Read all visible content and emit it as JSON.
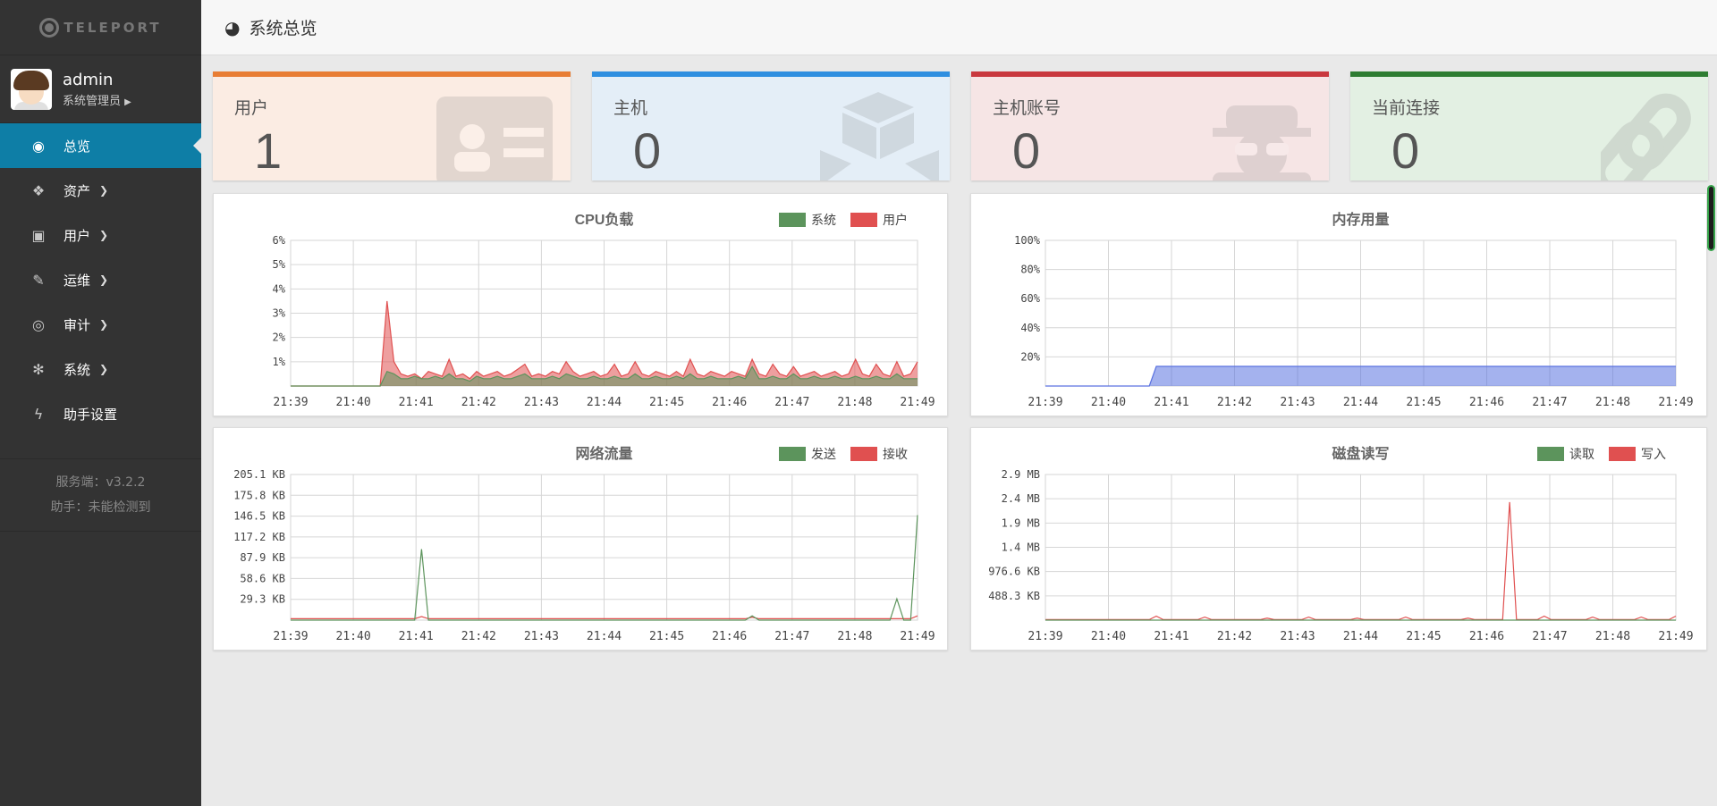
{
  "sidebar": {
    "logo": "TELEPORT",
    "user": {
      "name": "admin",
      "role": "系统管理员"
    },
    "items": [
      {
        "label": "总览",
        "icon": "dashboard-icon",
        "glyph": "◉",
        "active": true,
        "expandable": false
      },
      {
        "label": "资产",
        "icon": "cubes-icon",
        "glyph": "❖",
        "active": false,
        "expandable": true
      },
      {
        "label": "用户",
        "icon": "address-card-icon",
        "glyph": "▣",
        "active": false,
        "expandable": true
      },
      {
        "label": "运维",
        "icon": "wrench-icon",
        "glyph": "✎",
        "active": false,
        "expandable": true
      },
      {
        "label": "审计",
        "icon": "eye-icon",
        "glyph": "◎",
        "active": false,
        "expandable": true
      },
      {
        "label": "系统",
        "icon": "gear-icon",
        "glyph": "✻",
        "active": false,
        "expandable": true
      },
      {
        "label": "助手设置",
        "icon": "bolt-icon",
        "glyph": "ϟ",
        "active": false,
        "expandable": false
      }
    ],
    "version": {
      "server": "服务端：v3.2.2",
      "assistant": "助手：未能检测到"
    }
  },
  "header": {
    "title": "系统总览",
    "icon": "dashboard-icon"
  },
  "cards": [
    {
      "title": "用户",
      "value": "1",
      "color": "#e87d34",
      "bg": "#fbece3",
      "icon": "id-card-icon"
    },
    {
      "title": "主机",
      "value": "0",
      "color": "#2f8fe0",
      "bg": "#e4eef7",
      "icon": "cubes-icon"
    },
    {
      "title": "主机账号",
      "value": "0",
      "color": "#c9383e",
      "bg": "#f6e5e5",
      "icon": "user-secret-icon"
    },
    {
      "title": "当前连接",
      "value": "0",
      "color": "#2e7d32",
      "bg": "#e3f0e3",
      "icon": "link-icon"
    }
  ],
  "colors": {
    "green": "#5c945c",
    "red": "#e05050",
    "blue": "#5a72e0",
    "grid": "#d6d6d6"
  },
  "chart_data": [
    {
      "type": "area",
      "title": "CPU负载",
      "legend": [
        "系统",
        "用户"
      ],
      "x": [
        "21:39",
        "21:40",
        "21:41",
        "21:42",
        "21:43",
        "21:44",
        "21:45",
        "21:46",
        "21:47",
        "21:48",
        "21:49"
      ],
      "y_ticks": [
        "6%",
        "5%",
        "4%",
        "3%",
        "2%",
        "1%"
      ],
      "ylim": [
        0,
        6
      ],
      "series": [
        {
          "name": "系统",
          "color": "#5c945c",
          "values": [
            0,
            0,
            0,
            0,
            0,
            0,
            0,
            0,
            0,
            0,
            0,
            0,
            0,
            0,
            0.6,
            0.5,
            0.3,
            0.3,
            0.4,
            0.3,
            0.3,
            0.4,
            0.3,
            0.5,
            0.3,
            0.3,
            0.2,
            0.4,
            0.3,
            0.3,
            0.4,
            0.3,
            0.3,
            0.4,
            0.5,
            0.3,
            0.3,
            0.3,
            0.4,
            0.3,
            0.5,
            0.4,
            0.3,
            0.3,
            0.4,
            0.3,
            0.3,
            0.4,
            0.3,
            0.3,
            0.5,
            0.3,
            0.3,
            0.4,
            0.3,
            0.3,
            0.4,
            0.3,
            0.5,
            0.3,
            0.3,
            0.4,
            0.3,
            0.3,
            0.3,
            0.4,
            0.3,
            0.8,
            0.3,
            0.3,
            0.4,
            0.3,
            0.3,
            0.5,
            0.3,
            0.3,
            0.4,
            0.3,
            0.3,
            0.4,
            0.3,
            0.3,
            0.4,
            0.3,
            0.3,
            0.4,
            0.3,
            0.3,
            0.5,
            0.3,
            0.3,
            0.3
          ]
        },
        {
          "name": "用户",
          "color": "#e05050",
          "values": [
            0,
            0,
            0,
            0,
            0,
            0,
            0,
            0,
            0,
            0,
            0,
            0,
            0,
            0,
            3.5,
            1,
            0.5,
            0.4,
            0.5,
            0.3,
            0.6,
            0.5,
            0.4,
            1.1,
            0.4,
            0.5,
            0.3,
            0.6,
            0.4,
            0.5,
            0.6,
            0.4,
            0.5,
            0.7,
            0.9,
            0.4,
            0.5,
            0.4,
            0.6,
            0.5,
            1,
            0.6,
            0.4,
            0.5,
            0.6,
            0.4,
            0.5,
            0.9,
            0.4,
            0.5,
            1,
            0.5,
            0.4,
            0.6,
            0.5,
            0.4,
            0.6,
            0.4,
            1.1,
            0.5,
            0.4,
            0.6,
            0.5,
            0.4,
            0.6,
            0.5,
            0.4,
            1.1,
            0.5,
            0.4,
            0.9,
            0.5,
            0.4,
            0.8,
            0.4,
            0.5,
            0.6,
            0.4,
            0.5,
            0.6,
            0.4,
            0.5,
            1.1,
            0.5,
            0.4,
            0.9,
            0.5,
            0.4,
            1,
            0.4,
            0.5,
            1
          ]
        }
      ]
    },
    {
      "type": "area",
      "title": "内存用量",
      "legend": [],
      "x": [
        "21:39",
        "21:40",
        "21:41",
        "21:42",
        "21:43",
        "21:44",
        "21:45",
        "21:46",
        "21:47",
        "21:48",
        "21:49"
      ],
      "y_ticks": [
        "100%",
        "80%",
        "60%",
        "40%",
        "20%"
      ],
      "ylim": [
        0,
        100
      ],
      "series": [
        {
          "name": "",
          "color": "#5a72e0",
          "values": [
            0,
            0,
            0,
            0,
            0,
            0,
            0,
            0,
            0,
            0,
            0,
            0,
            0,
            0,
            0,
            0,
            13.5,
            13.5,
            13.5,
            13.5,
            13.5,
            13.5,
            13.5,
            13.5,
            13.5,
            13.5,
            13.5,
            13.5,
            13.5,
            13.5,
            13.5,
            13.5,
            13.5,
            13.5,
            13.5,
            13.5,
            13.5,
            13.5,
            13.5,
            13.5,
            13.5,
            13.5,
            13.5,
            13.5,
            13.5,
            13.5,
            13.5,
            13.5,
            13.5,
            13.5,
            13.5,
            13.5,
            13.5,
            13.5,
            13.5,
            13.5,
            13.5,
            13.5,
            13.5,
            13.5,
            13.5,
            13.5,
            13.5,
            13.5,
            13.5,
            13.5,
            13.5,
            13.5,
            13.5,
            13.5,
            13.5,
            13.5,
            13.5,
            13.5,
            13.5,
            13.5,
            13.5,
            13.5,
            13.5,
            13.5,
            13.5,
            13.5,
            13.5,
            13.5,
            13.5,
            13.5,
            13.5,
            13.5,
            13.5,
            13.5,
            13.5,
            13.5
          ]
        }
      ]
    },
    {
      "type": "line",
      "title": "网络流量",
      "legend": [
        "发送",
        "接收"
      ],
      "x": [
        "21:39",
        "21:40",
        "21:41",
        "21:42",
        "21:43",
        "21:44",
        "21:45",
        "21:46",
        "21:47",
        "21:48",
        "21:49"
      ],
      "y_ticks": [
        "205.1 KB",
        "175.8 KB",
        "146.5 KB",
        "117.2 KB",
        "87.9 KB",
        "58.6 KB",
        "29.3 KB"
      ],
      "ylim": [
        0,
        205.1
      ],
      "series": [
        {
          "name": "发送",
          "color": "#5c945c",
          "values": [
            0,
            0,
            0,
            0,
            0,
            0,
            0,
            0,
            0,
            0,
            0,
            0,
            0,
            0,
            0,
            0,
            0,
            0,
            0,
            100,
            0,
            0,
            0,
            0,
            0,
            0,
            0,
            0,
            0,
            0,
            0,
            0,
            0,
            0,
            0,
            0,
            0,
            0,
            0,
            0,
            0,
            0,
            0,
            0,
            0,
            0,
            0,
            0,
            0,
            0,
            0,
            0,
            0,
            0,
            0,
            0,
            0,
            0,
            0,
            0,
            0,
            0,
            0,
            0,
            0,
            0,
            0,
            6,
            0,
            0,
            0,
            0,
            0,
            0,
            0,
            0,
            0,
            0,
            0,
            0,
            0,
            0,
            0,
            0,
            0,
            0,
            0,
            0,
            30,
            0,
            0,
            148
          ]
        },
        {
          "name": "接收",
          "color": "#e05050",
          "values": [
            2,
            2,
            2,
            2,
            2,
            2,
            2,
            2,
            2,
            2,
            2,
            2,
            2,
            2,
            2,
            2,
            2,
            2,
            2,
            5,
            2,
            2,
            2,
            2,
            2,
            2,
            2,
            2,
            2,
            2,
            2,
            2,
            2,
            2,
            2,
            2,
            2,
            2,
            2,
            2,
            2,
            2,
            2,
            2,
            2,
            2,
            2,
            2,
            2,
            2,
            2,
            2,
            2,
            2,
            2,
            2,
            2,
            2,
            2,
            2,
            2,
            2,
            2,
            2,
            2,
            2,
            2,
            4,
            2,
            2,
            2,
            2,
            2,
            2,
            2,
            2,
            2,
            2,
            2,
            2,
            2,
            2,
            2,
            2,
            2,
            2,
            2,
            2,
            2,
            2,
            2,
            6
          ]
        }
      ]
    },
    {
      "type": "line",
      "title": "磁盘读写",
      "legend": [
        "读取",
        "写入"
      ],
      "x": [
        "21:39",
        "21:40",
        "21:41",
        "21:42",
        "21:43",
        "21:44",
        "21:45",
        "21:46",
        "21:47",
        "21:48",
        "21:49"
      ],
      "y_ticks": [
        "2.9 MB",
        "2.4 MB",
        "1.9 MB",
        "1.4 MB",
        "976.6 KB",
        "488.3 KB"
      ],
      "ylim": [
        0,
        2.9
      ],
      "series": [
        {
          "name": "读取",
          "color": "#5c945c",
          "values": [
            0,
            0,
            0,
            0,
            0,
            0,
            0,
            0,
            0,
            0,
            0,
            0,
            0,
            0,
            0,
            0,
            0,
            0,
            0,
            0,
            0,
            0,
            0,
            0,
            0,
            0,
            0,
            0,
            0,
            0,
            0,
            0,
            0,
            0,
            0,
            0,
            0,
            0,
            0,
            0,
            0,
            0,
            0,
            0,
            0,
            0,
            0,
            0,
            0,
            0,
            0,
            0,
            0,
            0,
            0,
            0,
            0,
            0,
            0,
            0,
            0,
            0,
            0,
            0,
            0,
            0,
            0,
            0,
            0,
            0,
            0,
            0,
            0,
            0,
            0,
            0,
            0,
            0,
            0,
            0,
            0,
            0,
            0,
            0,
            0,
            0,
            0,
            0,
            0,
            0,
            0,
            0
          ]
        },
        {
          "name": "写入",
          "color": "#e05050",
          "values": [
            0.01,
            0.01,
            0.01,
            0.01,
            0.01,
            0.01,
            0.01,
            0.01,
            0.01,
            0.01,
            0.01,
            0.01,
            0.01,
            0.01,
            0.01,
            0.01,
            0.08,
            0.01,
            0.01,
            0.01,
            0.01,
            0.01,
            0.01,
            0.06,
            0.01,
            0.01,
            0.01,
            0.01,
            0.01,
            0.01,
            0.01,
            0.01,
            0.04,
            0.01,
            0.01,
            0.01,
            0.01,
            0.01,
            0.06,
            0.01,
            0.01,
            0.01,
            0.01,
            0.01,
            0.01,
            0.04,
            0.01,
            0.01,
            0.01,
            0.01,
            0.01,
            0.01,
            0.06,
            0.01,
            0.01,
            0.01,
            0.01,
            0.01,
            0.01,
            0.01,
            0.01,
            0.04,
            0.01,
            0.01,
            0.01,
            0.01,
            0.01,
            2.35,
            0.01,
            0.01,
            0.01,
            0.01,
            0.08,
            0.01,
            0.01,
            0.01,
            0.01,
            0.01,
            0.01,
            0.06,
            0.01,
            0.01,
            0.01,
            0.01,
            0.01,
            0.01,
            0.06,
            0.01,
            0.01,
            0.01,
            0.01,
            0.08
          ]
        }
      ]
    }
  ]
}
